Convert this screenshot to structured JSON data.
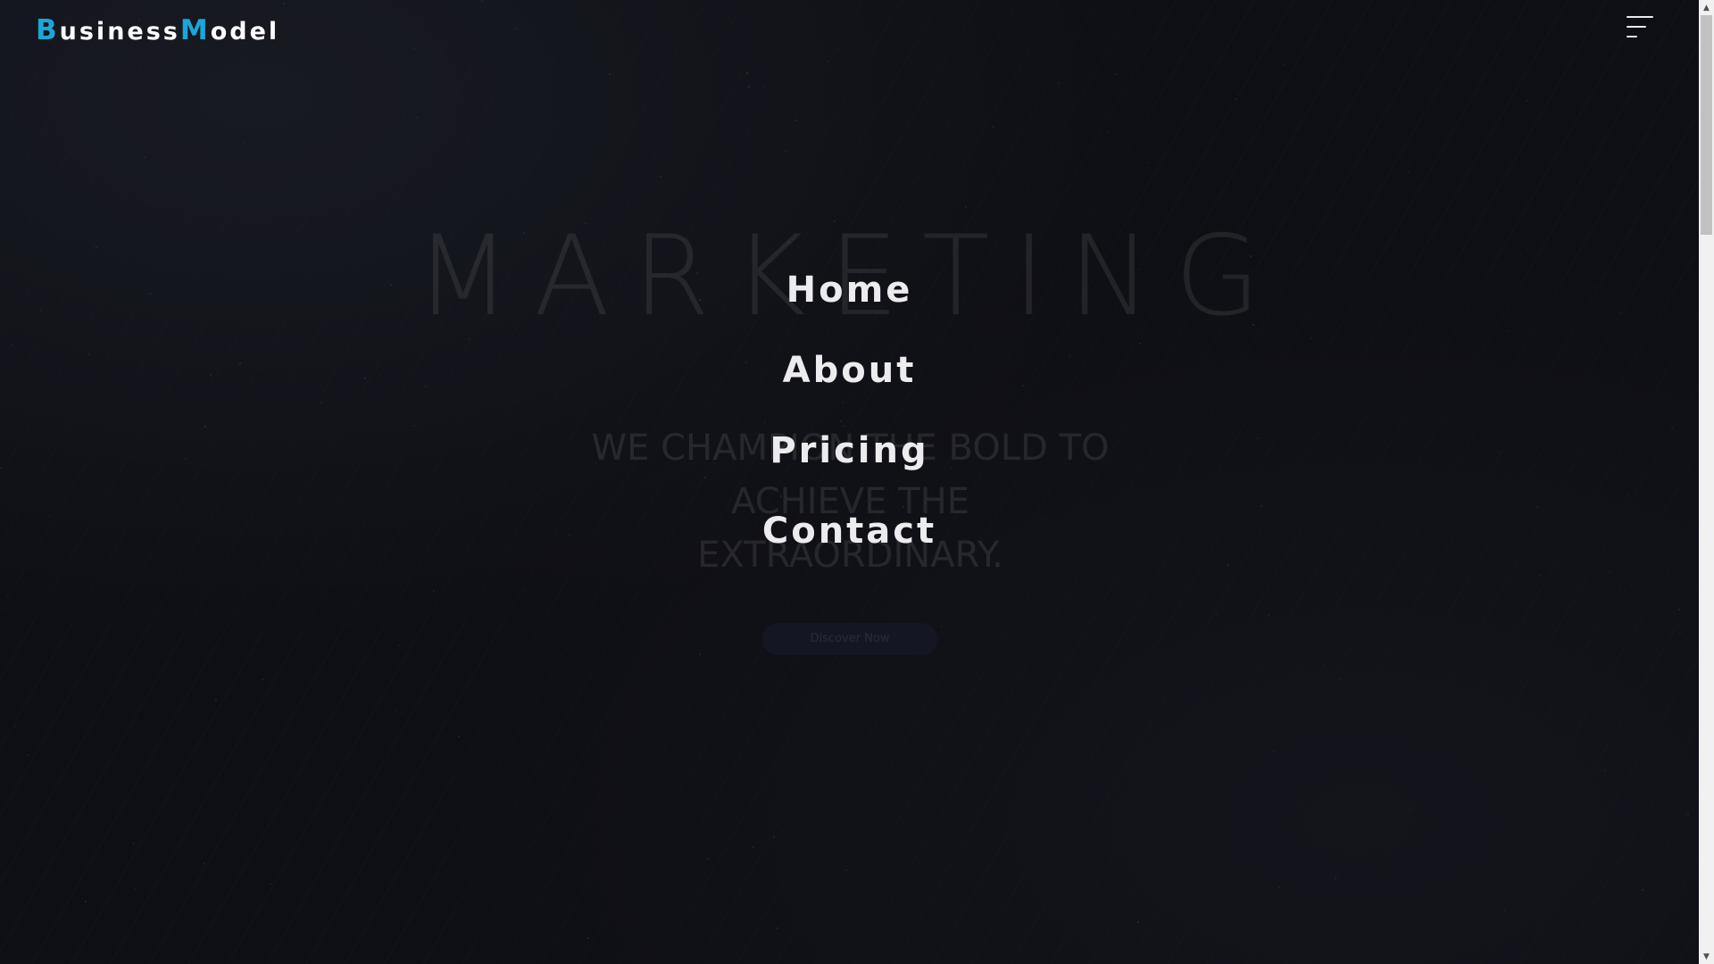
{
  "brand": {
    "logo_first_initial": "B",
    "logo_first_rest": "usiness",
    "logo_second_initial": "M",
    "logo_second_rest": "odel",
    "accent_color": "#1aa6d9"
  },
  "header": {
    "menu_icon": "hamburger-menu-icon"
  },
  "hero": {
    "title": "MARKETING",
    "subtitle": "WE CHAMPION THE BOLD TO ACHIEVE THE EXTRAORDINARY.",
    "cta_label": "Discover Now"
  },
  "menu": {
    "items": [
      {
        "label": "Home"
      },
      {
        "label": "About"
      },
      {
        "label": "Pricing"
      },
      {
        "label": "Contact"
      }
    ]
  },
  "scrollbar": {
    "up_icon": "scroll-up-arrow-icon",
    "down_icon": "scroll-down-arrow-icon"
  }
}
